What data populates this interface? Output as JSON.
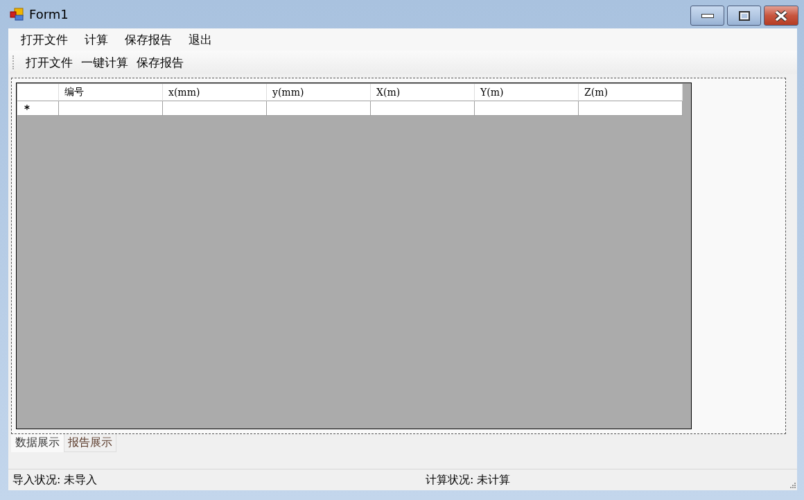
{
  "window": {
    "title": "Form1"
  },
  "menu": [
    {
      "label": "打开文件"
    },
    {
      "label": "计算"
    },
    {
      "label": "保存报告"
    },
    {
      "label": "退出"
    }
  ],
  "toolbar": [
    {
      "label": "打开文件"
    },
    {
      "label": "一键计算"
    },
    {
      "label": "保存报告"
    }
  ],
  "table": {
    "columns": [
      "编号",
      "x(mm)",
      "y(mm)",
      "X(m)",
      "Y(m)",
      "Z(m)"
    ],
    "new_row_marker": "*"
  },
  "tabs": [
    {
      "label": "数据展示",
      "selected": true
    },
    {
      "label": "报告展示",
      "selected": false
    }
  ],
  "status_bar": [
    {
      "label": "导入状况:",
      "value": "未导入"
    },
    {
      "label": "计算状况:",
      "value": "未计算"
    }
  ]
}
